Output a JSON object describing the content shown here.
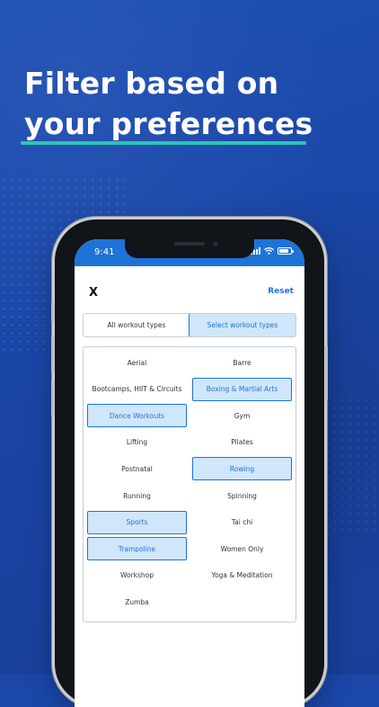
{
  "headline": {
    "line1": "Filter based on",
    "line2": "your preferences",
    "underline_color": "#2ec4b6"
  },
  "status_bar": {
    "time": "9:41",
    "background": "#1e73d8",
    "battery_level": 0.8
  },
  "header": {
    "close_label": "X",
    "reset_label": "Reset"
  },
  "segmented": {
    "options": [
      "All workout types",
      "Select workout types"
    ],
    "selected": "Select workout types"
  },
  "workout_types": [
    {
      "label": "Aerial",
      "selected": false
    },
    {
      "label": "Barre",
      "selected": false
    },
    {
      "label": "Bootcamps, HIIT & Circuits",
      "selected": false
    },
    {
      "label": "Boxing & Martial Arts",
      "selected": true
    },
    {
      "label": "Dance Workouts",
      "selected": true
    },
    {
      "label": "Gym",
      "selected": false
    },
    {
      "label": "Lifting",
      "selected": false
    },
    {
      "label": "Pilates",
      "selected": false
    },
    {
      "label": "Postnatal",
      "selected": false
    },
    {
      "label": "Rowing",
      "selected": true
    },
    {
      "label": "Running",
      "selected": false
    },
    {
      "label": "Spinning",
      "selected": false
    },
    {
      "label": "Sports",
      "selected": true
    },
    {
      "label": "Tai chi",
      "selected": false
    },
    {
      "label": "Trampoline",
      "selected": true
    },
    {
      "label": "Women Only",
      "selected": false
    },
    {
      "label": "Workshop",
      "selected": false
    },
    {
      "label": "Yoga & Meditation",
      "selected": false
    },
    {
      "label": "Zumba",
      "selected": false
    }
  ],
  "colors": {
    "background": "#1a47a8",
    "accent": "#1e73d8",
    "selected_fill": "#cfe6fb"
  }
}
